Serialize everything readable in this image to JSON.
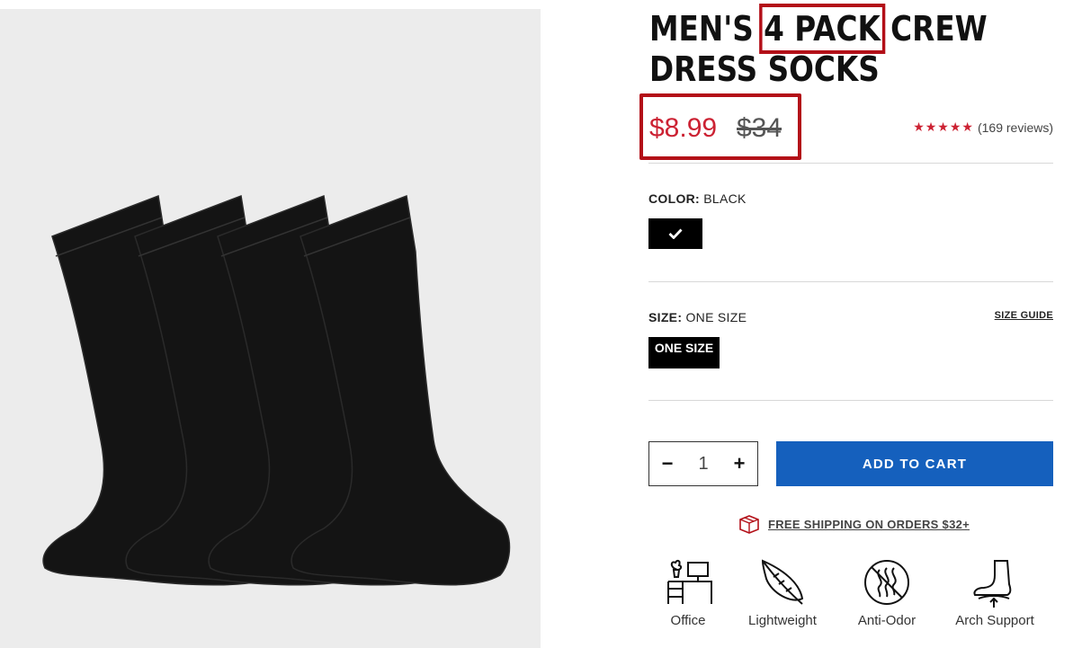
{
  "product": {
    "title_part1": "MEN'S ",
    "title_highlight": "4 PACK",
    "title_part2": " CREW",
    "title_line2": "DRESS SOCKS",
    "sale_price": "$8.99",
    "original_price": "$34",
    "stars": "★★★★★",
    "reviews": "(169 reviews)"
  },
  "color": {
    "label": "COLOR:",
    "value": "BLACK",
    "swatch_icon": "check-icon",
    "swatch_color": "#000000"
  },
  "size": {
    "label": "SIZE:",
    "value": "ONE SIZE",
    "button": "ONE SIZE",
    "guide": "SIZE GUIDE"
  },
  "quantity": {
    "minus": "−",
    "value": "1",
    "plus": "+"
  },
  "cart": {
    "label": "ADD TO CART"
  },
  "shipping": {
    "text": "FREE SHIPPING ON ORDERS $32+",
    "icon": "package-icon"
  },
  "features": [
    {
      "label": "Office",
      "icon": "office-desk-icon"
    },
    {
      "label": "Lightweight",
      "icon": "feather-icon"
    },
    {
      "label": "Anti-Odor",
      "icon": "anti-odor-icon"
    },
    {
      "label": "Arch Support",
      "icon": "foot-arch-icon"
    }
  ],
  "colors": {
    "sale": "#cc2233",
    "cart": "#1560bd",
    "highlight": "#b30f18",
    "gallery_bg": "#ececec"
  }
}
